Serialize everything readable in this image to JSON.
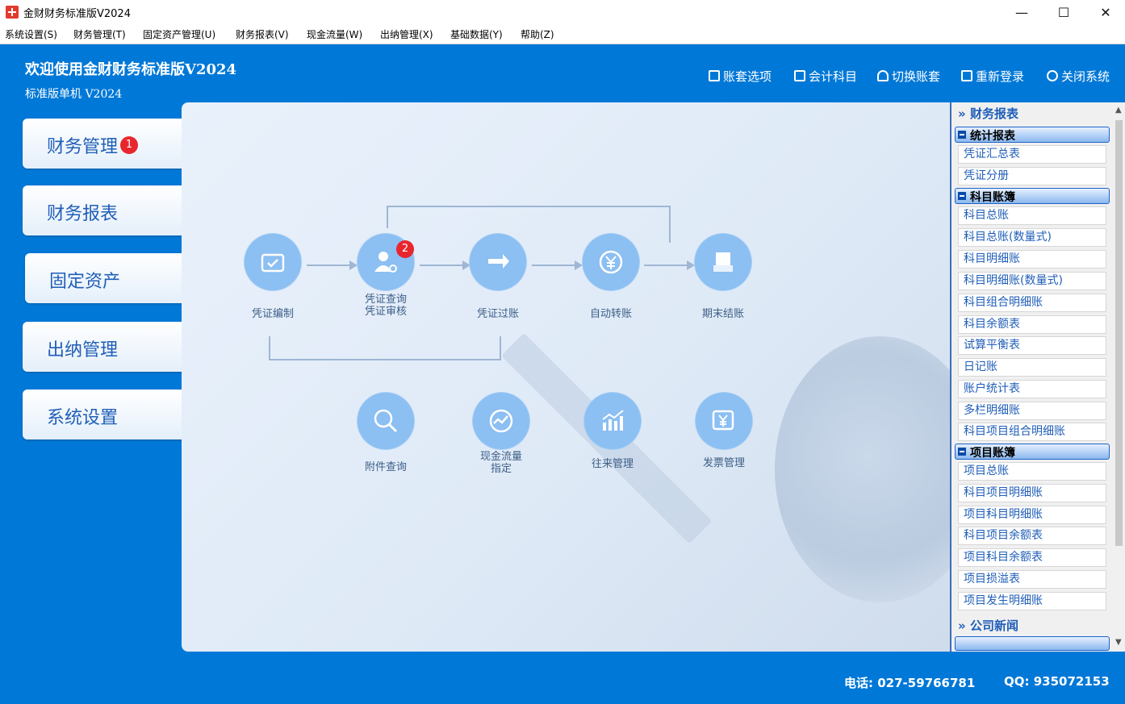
{
  "window": {
    "title": "金财财务标准版V2024",
    "min": "—",
    "max": "☐",
    "close": "✕"
  },
  "menu": [
    "系统设置(S)",
    "财务管理(T)",
    "固定资产管理(U)",
    "财务报表(V)",
    "现金流量(W)",
    "出纳管理(X)",
    "基础数据(Y)",
    "帮助(Z)"
  ],
  "header": {
    "title": "欢迎使用金财财务标准版V2024",
    "subtitle": "标准版单机  V2024"
  },
  "toplinks": [
    {
      "icon": "ledger-options-icon",
      "label": "账套选项"
    },
    {
      "icon": "account-subject-icon",
      "label": "会计科目"
    },
    {
      "icon": "switch-ledger-icon",
      "label": "切换账套"
    },
    {
      "icon": "relogin-icon",
      "label": "重新登录"
    },
    {
      "icon": "power-icon",
      "label": "关闭系统"
    }
  ],
  "sidebar": [
    {
      "label": "财务管理",
      "badge": "1"
    },
    {
      "label": "财务报表"
    },
    {
      "label": "固定资产"
    },
    {
      "label": "出纳管理"
    },
    {
      "label": "系统设置"
    }
  ],
  "flow": {
    "voucher_entry": "凭证编制",
    "voucher_query": "凭证查询",
    "voucher_audit": "凭证审核",
    "voucher_query_badge": "2",
    "voucher_posting": "凭证过账",
    "auto_transfer": "自动转账",
    "period_close": "期末结账",
    "attachment_query": "附件查询",
    "cashflow_line1": "现金流量",
    "cashflow_line2": "指定",
    "ar_ap_manage": "往来管理",
    "invoice_manage": "发票管理"
  },
  "right_panel": {
    "header": "财务报表",
    "groups": [
      {
        "title": "统计报表",
        "items": [
          "凭证汇总表",
          "凭证分册"
        ]
      },
      {
        "title": "科目账簿",
        "items": [
          "科目总账",
          "科目总账(数量式)",
          "科目明细账",
          "科目明细账(数量式)",
          "科目组合明细账",
          "科目余额表",
          "试算平衡表",
          "日记账",
          "账户统计表",
          "多栏明细账",
          "科目项目组合明细账"
        ]
      },
      {
        "title": "项目账簿",
        "items": [
          "项目总账",
          "科目项目明细账",
          "项目科目明细账",
          "科目项目余额表",
          "项目科目余额表",
          "项目损溢表",
          "项目发生明细账"
        ]
      }
    ],
    "news_header": "公司新闻"
  },
  "footer": {
    "phone": "电话: 027-59766781",
    "qq": "QQ: 935072153"
  },
  "colors": {
    "background": "#0078d7",
    "node": "#8cbff2",
    "badge": "#e8262d",
    "link_text": "#1f5eb8"
  }
}
